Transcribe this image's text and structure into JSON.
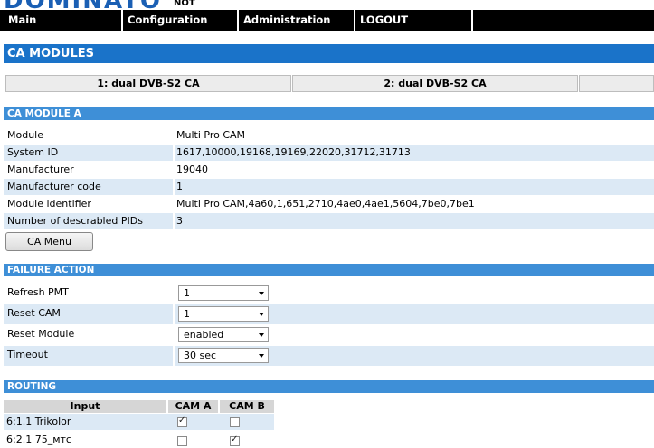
{
  "brand": {
    "name": "DOMINATO",
    "sub": "NOT"
  },
  "nav": [
    {
      "label": "Main"
    },
    {
      "label": "Configuration"
    },
    {
      "label": "Administration"
    },
    {
      "label": "LOGOUT"
    }
  ],
  "page_title": "CA MODULES",
  "tabs": [
    {
      "label": "1: dual DVB-S2 CA"
    },
    {
      "label": "2: dual DVB-S2 CA"
    },
    {
      "label": ""
    }
  ],
  "ca_module": {
    "header": "CA MODULE A",
    "rows": [
      {
        "key": "Module",
        "value": "Multi Pro CAM"
      },
      {
        "key": "System ID",
        "value": "1617,10000,19168,19169,22020,31712,31713"
      },
      {
        "key": "Manufacturer",
        "value": "19040"
      },
      {
        "key": "Manufacturer code",
        "value": "1"
      },
      {
        "key": "Module identifier",
        "value": "Multi Pro CAM,4a60,1,651,2710,4ae0,4ae1,5604,7be0,7be1"
      },
      {
        "key": "Number of descrabled PIDs",
        "value": "3"
      }
    ],
    "menu_button": "CA Menu"
  },
  "failure_action": {
    "header": "FAILURE ACTION",
    "rows": [
      {
        "key": "Refresh PMT",
        "value": "1"
      },
      {
        "key": "Reset CAM",
        "value": "1"
      },
      {
        "key": "Reset Module",
        "value": "enabled"
      },
      {
        "key": "Timeout",
        "value": "30 sec"
      }
    ]
  },
  "routing": {
    "header": "ROUTING",
    "columns": [
      "Input",
      "CAM A",
      "CAM B"
    ],
    "rows": [
      {
        "input": "6:1.1 Trikolor",
        "cam_a": true,
        "cam_b": false
      },
      {
        "input": "6:2.1 75_мтс",
        "cam_a": false,
        "cam_b": true
      }
    ]
  },
  "colors": {
    "header_blue": "#1a73c9",
    "subheader_blue": "#3e8fd7",
    "row_alt": "#dce9f5"
  }
}
